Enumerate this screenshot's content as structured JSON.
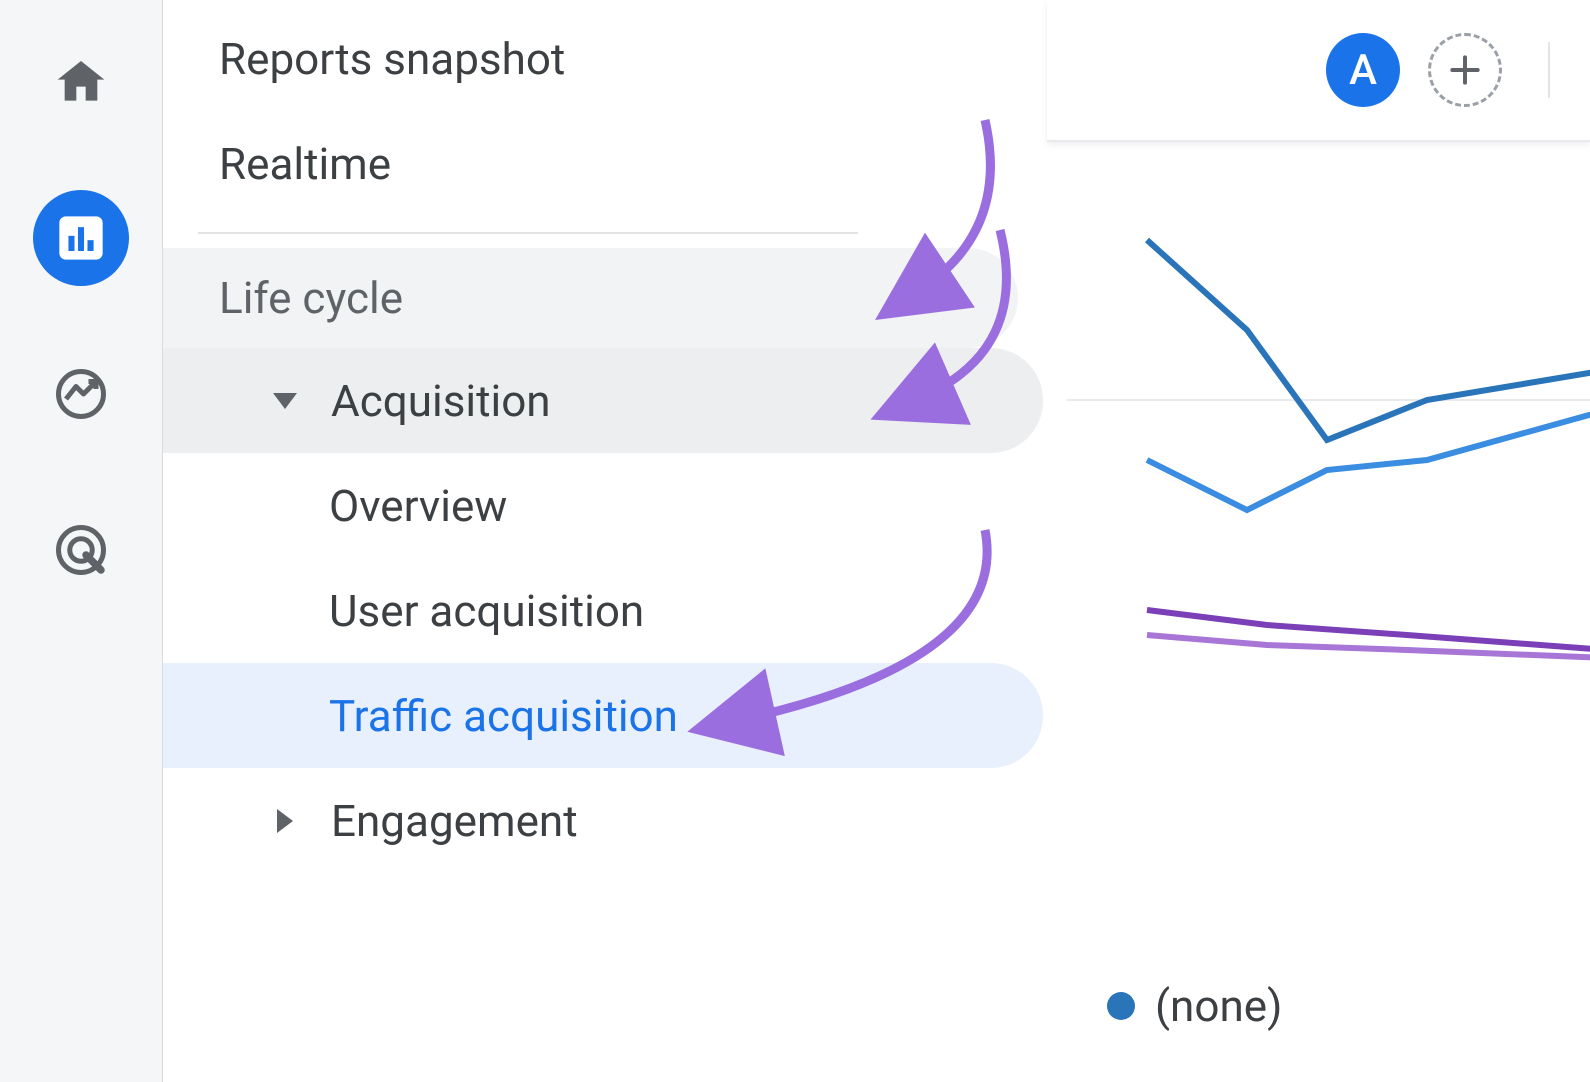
{
  "rail": {
    "items": [
      {
        "name": "home-icon",
        "active": false
      },
      {
        "name": "reports-icon",
        "active": true
      },
      {
        "name": "explore-icon",
        "active": false
      },
      {
        "name": "advertising-icon",
        "active": false
      }
    ]
  },
  "nav": {
    "reports_snapshot": "Reports snapshot",
    "realtime": "Realtime",
    "lifecycle_section": "Life cycle",
    "acquisition": {
      "label": "Acquisition",
      "items": {
        "overview": "Overview",
        "user_acquisition": "User acquisition",
        "traffic_acquisition": "Traffic acquisition"
      }
    },
    "engagement": "Engagement"
  },
  "toolbar": {
    "segment_letter": "A"
  },
  "chart": {
    "legend_first": "(none)",
    "series_colors": {
      "s1": "#2a74ba",
      "s2": "#3a8de0",
      "s3": "#7b3fb8",
      "s4": "#a876d6"
    }
  },
  "annotations": {
    "arrow_color": "#9b6ee0"
  }
}
